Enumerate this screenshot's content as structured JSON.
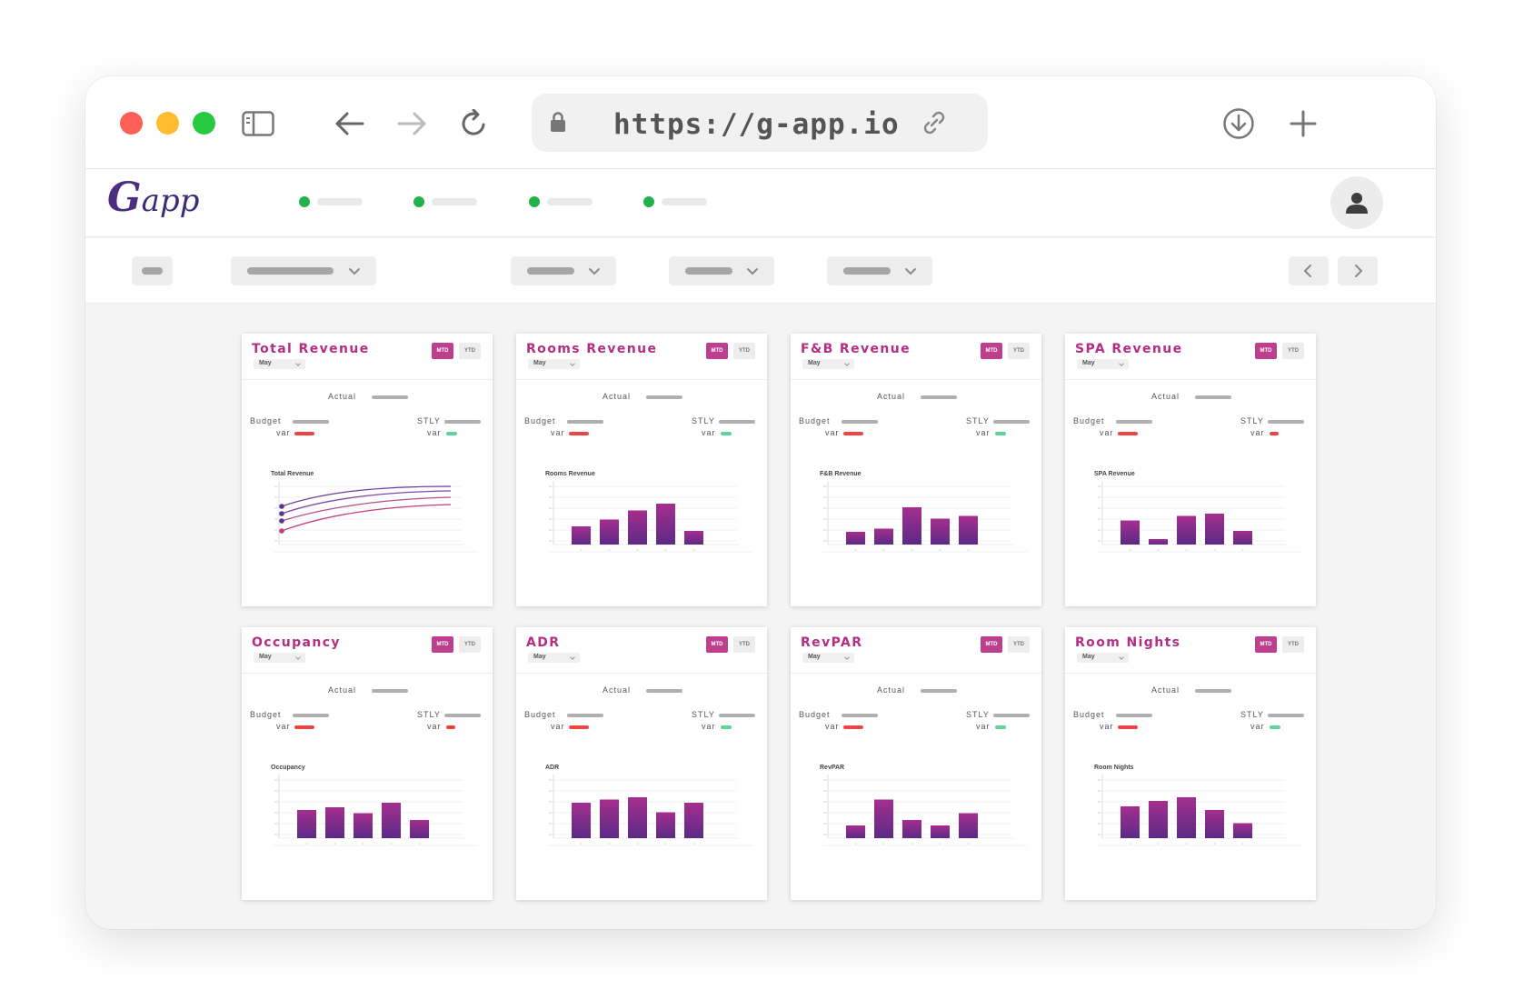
{
  "browser": {
    "url": "https://g-app.io"
  },
  "app": {
    "logo_initial": "G",
    "logo_rest": "app"
  },
  "colors": {
    "accent": "#b42d85",
    "nav_dot": "#22b24c",
    "var_negative": "#ef4444",
    "var_positive": "#5ed39a"
  },
  "cards": [
    {
      "title": "Total Revenue",
      "month": "May",
      "mtd": "MTD",
      "ytd": "YTD",
      "actual_label": "Actual",
      "budget_label": "Budget",
      "stly_label": "STLY",
      "var_label": "var",
      "chart_title": "Total Revenue",
      "chart_type": "line",
      "budget_var_status": "negative",
      "stly_var_status": "positive"
    },
    {
      "title": "Rooms Revenue",
      "month": "May",
      "mtd": "MTD",
      "ytd": "YTD",
      "actual_label": "Actual",
      "budget_label": "Budget",
      "stly_label": "STLY",
      "var_label": "var",
      "chart_title": "Rooms Revenue",
      "chart_type": "bar",
      "bars": [
        0.4,
        0.55,
        0.75,
        0.9,
        0.3
      ],
      "budget_var_status": "negative",
      "stly_var_status": "positive"
    },
    {
      "title": "F&B Revenue",
      "month": "May",
      "mtd": "MTD",
      "ytd": "YTD",
      "actual_label": "Actual",
      "budget_label": "Budget",
      "stly_label": "STLY",
      "var_label": "var",
      "chart_title": "F&B Revenue",
      "chart_type": "bar",
      "bars": [
        0.28,
        0.35,
        0.82,
        0.57,
        0.63
      ],
      "budget_var_status": "negative",
      "stly_var_status": "positive"
    },
    {
      "title": "SPA Revenue",
      "month": "May",
      "mtd": "MTD",
      "ytd": "YTD",
      "actual_label": "Actual",
      "budget_label": "Budget",
      "stly_label": "STLY",
      "var_label": "var",
      "chart_title": "SPA Revenue",
      "chart_type": "bar",
      "bars": [
        0.53,
        0.12,
        0.63,
        0.68,
        0.3
      ],
      "budget_var_status": "negative",
      "stly_var_status": "negative"
    },
    {
      "title": "Occupancy",
      "month": "May",
      "mtd": "MTD",
      "ytd": "YTD",
      "actual_label": "Actual",
      "budget_label": "Budget",
      "stly_label": "STLY",
      "var_label": "var",
      "chart_title": "Occupancy",
      "chart_type": "bar",
      "bars": [
        0.62,
        0.68,
        0.55,
        0.78,
        0.4
      ],
      "budget_var_status": "negative",
      "stly_var_status": "negative"
    },
    {
      "title": "ADR",
      "month": "May",
      "mtd": "MTD",
      "ytd": "YTD",
      "actual_label": "Actual",
      "budget_label": "Budget",
      "stly_label": "STLY",
      "var_label": "var",
      "chart_title": "ADR",
      "chart_type": "bar",
      "bars": [
        0.78,
        0.85,
        0.9,
        0.57,
        0.78
      ],
      "budget_var_status": "negative",
      "stly_var_status": "positive"
    },
    {
      "title": "RevPAR",
      "month": "May",
      "mtd": "MTD",
      "ytd": "YTD",
      "actual_label": "Actual",
      "budget_label": "Budget",
      "stly_label": "STLY",
      "var_label": "var",
      "chart_title": "RevPAR",
      "chart_type": "bar",
      "bars": [
        0.28,
        0.85,
        0.4,
        0.28,
        0.55
      ],
      "budget_var_status": "negative",
      "stly_var_status": "positive"
    },
    {
      "title": "Room Nights",
      "month": "May",
      "mtd": "MTD",
      "ytd": "YTD",
      "actual_label": "Actual",
      "budget_label": "Budget",
      "stly_label": "STLY",
      "var_label": "var",
      "chart_title": "Room Nights",
      "chart_type": "bar",
      "bars": [
        0.7,
        0.82,
        0.9,
        0.62,
        0.33
      ],
      "budget_var_status": "negative",
      "stly_var_status": "positive"
    }
  ]
}
